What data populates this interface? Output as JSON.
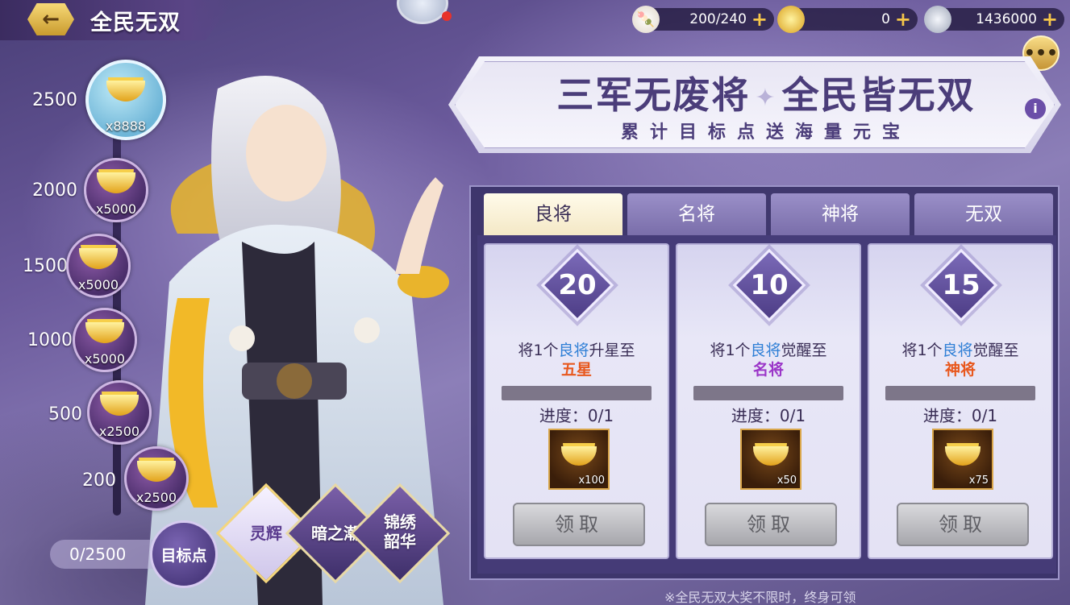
{
  "header": {
    "title": "全民无双",
    "back_icon": "arrow-left-icon"
  },
  "resources": [
    {
      "icon": "stamina-bun-icon",
      "value": "200/240"
    },
    {
      "icon": "gold-ingot-icon",
      "value": "0"
    },
    {
      "icon": "silver-coin-icon",
      "value": "1436000"
    }
  ],
  "banner": {
    "title_left": "三军无废将",
    "title_sep": "✦",
    "title_right": "全民皆无双",
    "subtitle": "累计目标点送海量元宝"
  },
  "milestones": [
    {
      "points": "2500",
      "qty": "x8888"
    },
    {
      "points": "2000",
      "qty": "x5000"
    },
    {
      "points": "1500",
      "qty": "x5000"
    },
    {
      "points": "1000",
      "qty": "x5000"
    },
    {
      "points": "500",
      "qty": "x2500"
    },
    {
      "points": "200",
      "qty": "x2500"
    }
  ],
  "progress": {
    "value": "0/2500",
    "target_label": "目标点"
  },
  "skins": [
    {
      "label": "灵辉"
    },
    {
      "label": "暗之潮"
    },
    {
      "label": "锦绣\n韶华"
    }
  ],
  "tabs": [
    {
      "label": "良将"
    },
    {
      "label": "名将"
    },
    {
      "label": "神将"
    },
    {
      "label": "无双"
    }
  ],
  "tasks": [
    {
      "points": "20",
      "prefix": "将1个",
      "highlight": "良将",
      "suffix": "升星至",
      "target": "五星",
      "target_color": "#e8581e",
      "progress": "进度：0/1",
      "progress_fraction": 0,
      "reward_qty": "x100",
      "claim_label": "领取"
    },
    {
      "points": "10",
      "prefix": "将1个",
      "highlight": "良将",
      "suffix": "觉醒至",
      "target": "名将",
      "target_color": "#9b36c8",
      "progress": "进度：0/1",
      "progress_fraction": 0,
      "reward_qty": "x50",
      "claim_label": "领取"
    },
    {
      "points": "15",
      "prefix": "将1个",
      "highlight": "良将",
      "suffix": "觉醒至",
      "target": "神将",
      "target_color": "#e8581e",
      "progress": "进度：0/1",
      "progress_fraction": 0,
      "reward_qty": "x75",
      "claim_label": "领取"
    }
  ],
  "footnote": "※全民无双大奖不限时，终身可领"
}
